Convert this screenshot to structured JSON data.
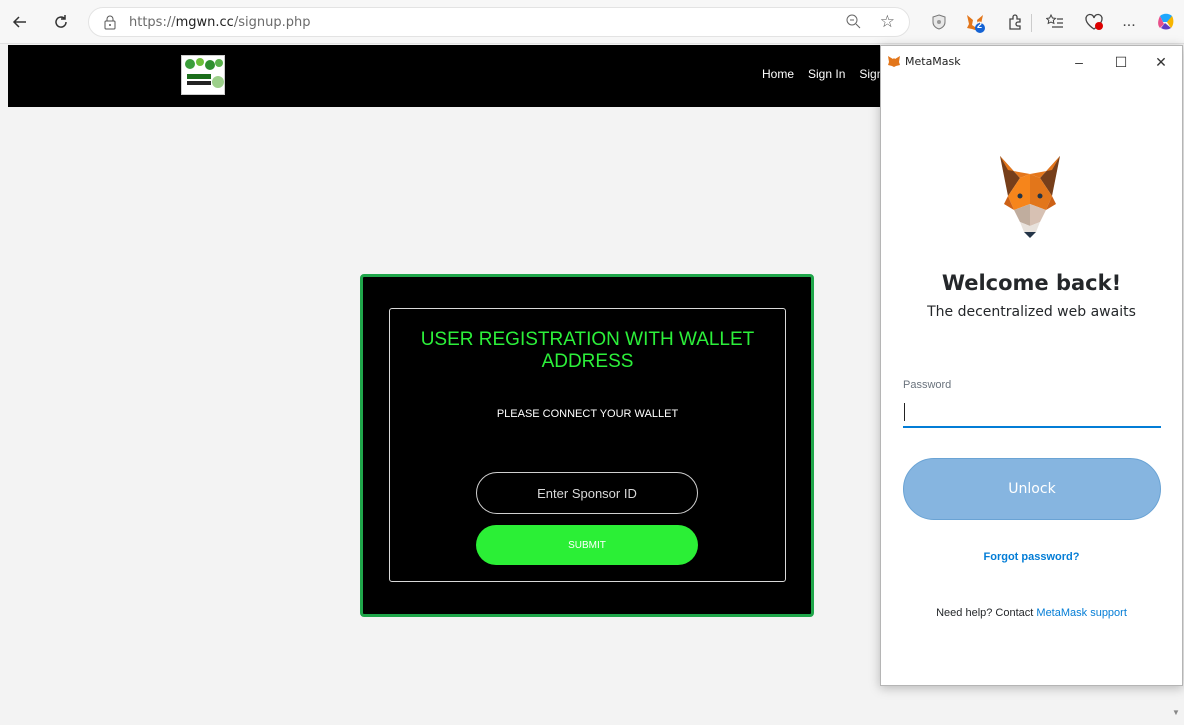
{
  "browser": {
    "url_prefix": "https://",
    "url_domain": "mgwn.cc",
    "url_path": "/signup.php",
    "extension_badge": "2",
    "more_label": "..."
  },
  "site": {
    "nav": [
      "Home",
      "Sign In",
      "Sign"
    ],
    "registration": {
      "title": "USER REGISTRATION WITH WALLET ADDRESS",
      "subtitle": "PLEASE CONNECT YOUR WALLET",
      "sponsor_placeholder": "Enter Sponsor ID",
      "submit_label": "SUBMIT"
    },
    "colors": {
      "header_bg": "#000000",
      "accent_green": "#2bef36",
      "card_border": "#1fa64a"
    }
  },
  "metamask": {
    "window_title": "MetaMask",
    "welcome": "Welcome back!",
    "tagline": "The decentralized web awaits",
    "password_label": "Password",
    "password_value": "",
    "unlock_label": "Unlock",
    "forgot_label": "Forgot password?",
    "help_prefix": "Need help? Contact ",
    "help_link": "MetaMask support",
    "colors": {
      "link_blue": "#037dd6",
      "unlock_bg": "#86b5e0"
    }
  }
}
